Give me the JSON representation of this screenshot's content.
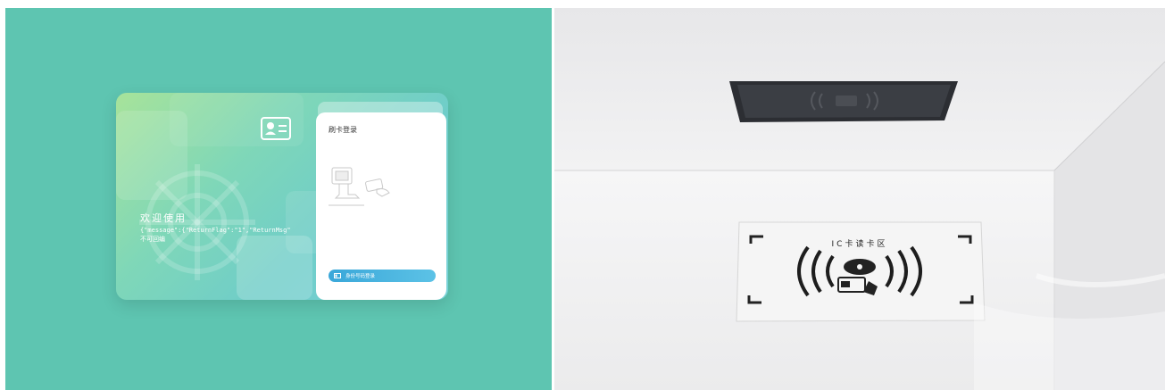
{
  "left": {
    "welcome_title": "欢迎使用",
    "message_text": "{\"message\":{\"ReturnFlag\":\"1\",\"ReturnMsg\"",
    "sub_text": "不可回编",
    "panel": {
      "title": "刷卡登录",
      "button_label": "身份号码登录"
    }
  },
  "right": {
    "reader_label": "IC卡读卡区"
  },
  "colors": {
    "background": "#5ec5b1",
    "card_gradient_start": "#a7e39a",
    "card_gradient_end": "#7ad2d8",
    "button": "#3aa7d9"
  }
}
